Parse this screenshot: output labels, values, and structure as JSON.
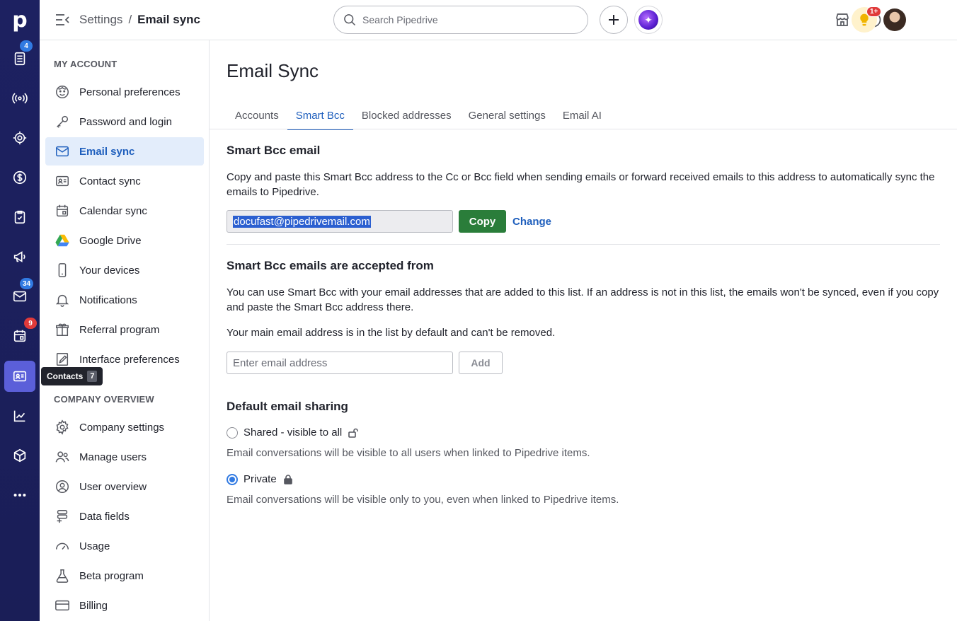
{
  "rail": {
    "logo": "p",
    "badges": {
      "deals": "4",
      "mail": "34",
      "activities": "9"
    },
    "tooltip": {
      "label": "Contacts",
      "count": "7"
    }
  },
  "topbar": {
    "breadcrumb_parent": "Settings",
    "breadcrumb_separator": "/",
    "breadcrumb_current": "Email sync",
    "search_placeholder": "Search Pipedrive",
    "notification_badge": "1+"
  },
  "sidebar": {
    "section_account": "MY ACCOUNT",
    "account_items": [
      "Personal preferences",
      "Password and login",
      "Email sync",
      "Contact sync",
      "Calendar sync",
      "Google Drive",
      "Your devices",
      "Notifications",
      "Referral program",
      "Interface preferences"
    ],
    "section_company": "COMPANY OVERVIEW",
    "company_items": [
      "Company settings",
      "Manage users",
      "User overview",
      "Data fields",
      "Usage",
      "Beta program",
      "Billing"
    ]
  },
  "main": {
    "title": "Email Sync",
    "tabs": [
      "Accounts",
      "Smart Bcc",
      "Blocked addresses",
      "General settings",
      "Email AI"
    ],
    "active_tab": "Smart Bcc",
    "smart_bcc": {
      "heading": "Smart Bcc email",
      "description": "Copy and paste this Smart Bcc address to the Cc or Bcc field when sending emails or forward received emails to this address to automatically sync the emails to Pipedrive.",
      "address": "docufast@pipedrivemail.com",
      "copy_label": "Copy",
      "change_label": "Change"
    },
    "accepted_from": {
      "heading": "Smart Bcc emails are accepted from",
      "description": "You can use Smart Bcc with your email addresses that are added to this list. If an address is not in this list, the emails won't be synced, even if you copy and paste the Smart Bcc address there.",
      "note": "Your main email address is in the list by default and can't be removed.",
      "input_placeholder": "Enter email address",
      "add_label": "Add"
    },
    "sharing": {
      "heading": "Default email sharing",
      "options": [
        {
          "label": "Shared - visible to all",
          "description": "Email conversations will be visible to all users when linked to Pipedrive items.",
          "checked": false
        },
        {
          "label": "Private",
          "description": "Email conversations will be visible only to you, even when linked to Pipedrive items.",
          "checked": true
        }
      ]
    }
  },
  "colors": {
    "rail_bg": "#1d2161",
    "accent_blue": "#1f5fbd",
    "copy_green": "#2a7d3a",
    "active_item_bg": "#e3edfb"
  }
}
